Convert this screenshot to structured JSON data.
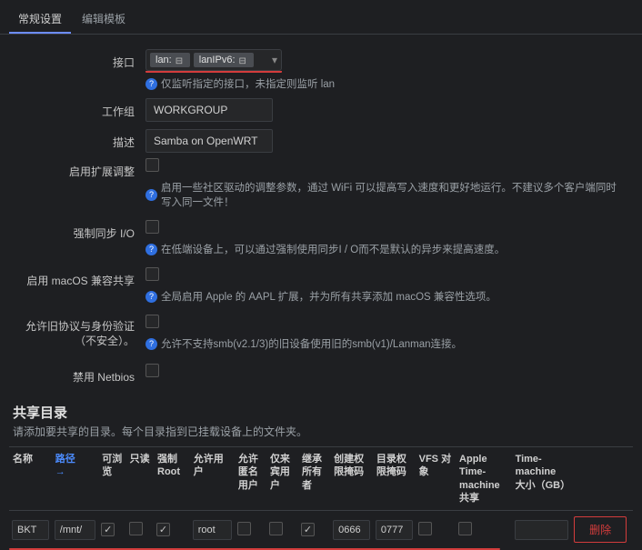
{
  "tabs": {
    "t0": "常规设置",
    "t1": "编辑模板"
  },
  "form": {
    "interface": {
      "label": "接口",
      "chips": {
        "c0": "lan:",
        "c1": "lanIPv6:"
      },
      "hint": "仅监听指定的接口，未指定则监听 lan"
    },
    "workgroup": {
      "label": "工作组",
      "value": "WORKGROUP"
    },
    "description": {
      "label": "描述",
      "value": "Samba on OpenWRT"
    },
    "ext_tuning": {
      "label": "启用扩展调整",
      "hint": "启用一些社区驱动的调整参数，通过 WiFi 可以提高写入速度和更好地运行。不建议多个客户端同时写入同一文件！"
    },
    "force_sync": {
      "label": "强制同步 I/O",
      "hint": "在低端设备上，可以通过强制使用同步I / O而不是默认的异步来提高速度。"
    },
    "macos": {
      "label": "启用 macOS 兼容共享",
      "hint": "全局启用 Apple 的 AAPL 扩展，并为所有共享添加 macOS 兼容性选项。"
    },
    "legacy": {
      "label": "允许旧协议与身份验证（不安全）。",
      "hint": "允许不支持smb(v2.1/3)的旧设备使用旧的smb(v1)/Lanman连接。"
    },
    "netbios": {
      "label": "禁用 Netbios"
    }
  },
  "shares": {
    "heading": "共享目录",
    "sub": "请添加要共享的目录。每个目录指到已挂载设备上的文件夹。",
    "headers": {
      "name": "名称",
      "path": "路径",
      "arrow": "→",
      "browse": "可浏览",
      "ro": "只读",
      "froot": "强制 Root",
      "users": "允许用户",
      "guest": "允许匿名用户",
      "guestonly": "仅来宾用户",
      "inherit": "继承所有者",
      "cmask": "创建权限掩码",
      "dmask": "目录权限掩码",
      "vfs": "VFS 对象",
      "tm": "Apple Time-machine 共享",
      "tmsize": "Time-machine 大小（GB）"
    },
    "row": {
      "name": "BKT",
      "path": "/mnt/",
      "users": "root",
      "cmask": "0666",
      "dmask": "0777",
      "delete": "删除"
    }
  }
}
